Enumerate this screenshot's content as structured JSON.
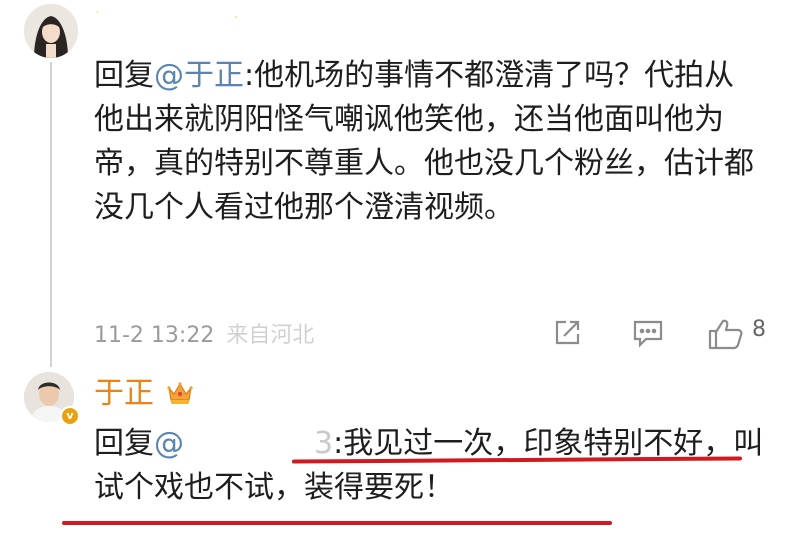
{
  "comment": {
    "reply_prefix": "回复",
    "mention": "@于正",
    "text": ":他机场的事情不都澄清了吗？代拍从他出来就阴阳怪气嘲讽他笑他，还当他面叫他为帝，真的特别不尊重人。他也没几个粉丝，估计都没几个人看过他那个澄清视频。",
    "time": "11-2 13:22",
    "location": "来自河北",
    "likes": "8",
    "icons": [
      "share-icon",
      "comment-icon",
      "like-icon"
    ]
  },
  "reply": {
    "username": "于正",
    "username_color": "#e8841a",
    "badge_icon": "crown-icon",
    "verified_badge": "v",
    "reply_prefix": "回复",
    "mention_at": "@",
    "mention_tail": "3",
    "text": ":我见过一次，印象特别不好，叫试个戏也不试，装得要死！"
  },
  "colors": {
    "mention": "#5b84b1",
    "underline": "#d11a1f",
    "meta": "#9b9b9b"
  }
}
